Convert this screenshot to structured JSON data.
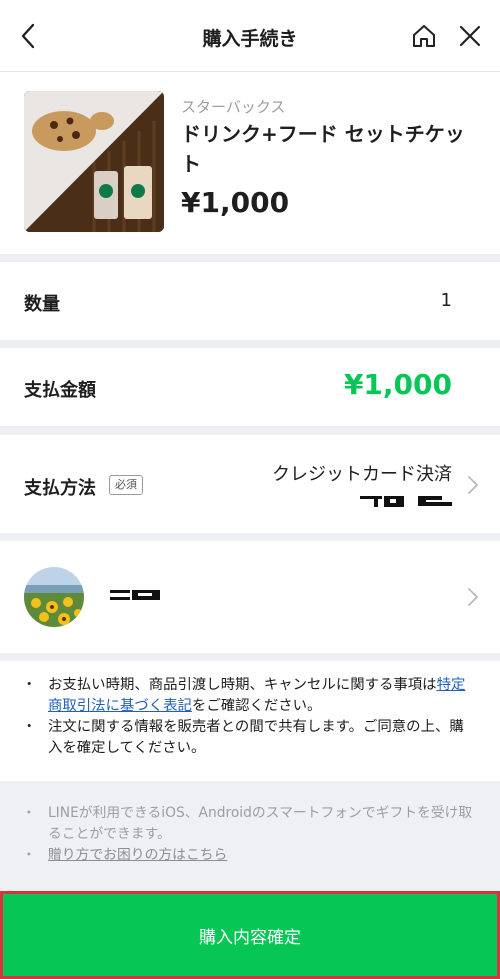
{
  "header": {
    "title": "購入手続き"
  },
  "product": {
    "brand": "スターバックス",
    "name": "ドリンク+フード セットチケット",
    "price": "¥1,000"
  },
  "quantity": {
    "label": "数量",
    "value": "1"
  },
  "amount": {
    "label": "支払金額",
    "value": "¥1,000"
  },
  "payment": {
    "label": "支払方法",
    "required_badge": "必須",
    "method": "クレジットカード決済"
  },
  "notes": {
    "item1_before": "お支払い時期、商品引渡し時期、キャンセルに関する事項は",
    "item1_link": "特定商取引法に基づく表記",
    "item1_after": "をご確認ください。",
    "item2": "注文に関する情報を販売者との間で共有します。ご同意の上、購入を確定してください。"
  },
  "info": {
    "item1": "LINEが利用できるiOS、Androidのスマートフォンでギフトを受け取ることができます。",
    "item2_link": "贈り方でお困りの方はこちら"
  },
  "confirm_button": "購入内容確定",
  "colors": {
    "accent_green": "#06c755",
    "highlight_border": "#d9333f"
  }
}
